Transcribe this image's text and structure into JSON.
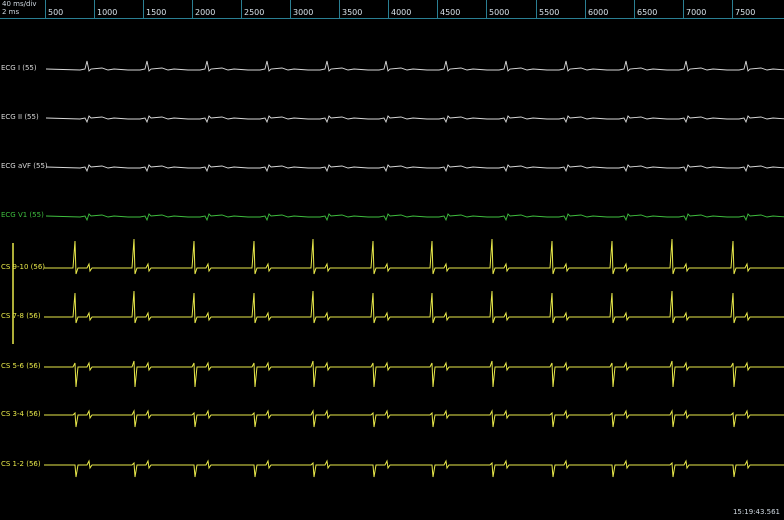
{
  "ruler": {
    "speed": "40 ms/div",
    "unit": "2 ms",
    "ticks": [
      "500",
      "1000",
      "1500",
      "2000",
      "2500",
      "3000",
      "3500",
      "4000",
      "4500",
      "5000",
      "5500",
      "6000",
      "6500",
      "7000",
      "7500"
    ]
  },
  "channels": [
    {
      "label": "ECG I (55)",
      "color": "#d9d9d9",
      "kind": "surface"
    },
    {
      "label": "ECG II (55)",
      "color": "#d9d9d9",
      "kind": "surface"
    },
    {
      "label": "ECG aVF (55)",
      "color": "#d9d9d9",
      "kind": "surface"
    },
    {
      "label": "ECG V1 (55)",
      "color": "#3fbf3f",
      "kind": "surface"
    },
    {
      "label": "CS 9-10 (56)",
      "color": "#e8e84a",
      "kind": "intracardiac"
    },
    {
      "label": "CS 7-8 (56)",
      "color": "#e8e84a",
      "kind": "intracardiac"
    },
    {
      "label": "CS 5-6 (56)",
      "color": "#e8e84a",
      "kind": "intracardiac"
    },
    {
      "label": "CS 3-4 (56)",
      "color": "#e8e84a",
      "kind": "intracardiac"
    },
    {
      "label": "CS 1-2 (56)",
      "color": "#e8e84a",
      "kind": "intracardiac"
    }
  ],
  "clock": "15:19:43.561"
}
